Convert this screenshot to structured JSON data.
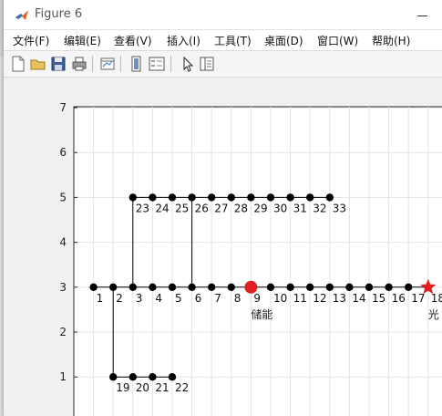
{
  "window": {
    "title": "Figure 6"
  },
  "menu": {
    "items": [
      {
        "label": "文件(F)"
      },
      {
        "label": "编辑(E)"
      },
      {
        "label": "查看(V)"
      },
      {
        "label": "插入(I)"
      },
      {
        "label": "工具(T)"
      },
      {
        "label": "桌面(D)"
      },
      {
        "label": "窗口(W)"
      },
      {
        "label": "帮助(H)"
      }
    ]
  },
  "toolbar": {
    "buttons": [
      "new-figure-icon",
      "open-file-icon",
      "save-icon",
      "print-icon",
      "link-plot-icon",
      "insert-colorbar-icon",
      "insert-legend-icon",
      "pointer-icon",
      "property-inspector-icon"
    ]
  },
  "colors": {
    "node": "#000000",
    "storage_node": "#e02020",
    "pv_marker": "#e02020",
    "grid": "#e3e3e3"
  },
  "chart_data": {
    "type": "scatter",
    "title": "",
    "xlabel": "",
    "ylabel": "",
    "ylim": [
      0,
      7
    ],
    "ytick_labels": [
      "7",
      "6",
      "5",
      "4",
      "3",
      "2",
      "1"
    ],
    "grid": true,
    "nodes": [
      {
        "id": "1",
        "x": 1,
        "y": 3
      },
      {
        "id": "2",
        "x": 2,
        "y": 3
      },
      {
        "id": "3",
        "x": 3,
        "y": 3
      },
      {
        "id": "4",
        "x": 4,
        "y": 3
      },
      {
        "id": "5",
        "x": 5,
        "y": 3
      },
      {
        "id": "6",
        "x": 6,
        "y": 3
      },
      {
        "id": "7",
        "x": 7,
        "y": 3
      },
      {
        "id": "8",
        "x": 8,
        "y": 3
      },
      {
        "id": "9",
        "x": 9,
        "y": 3,
        "kind": "storage"
      },
      {
        "id": "10",
        "x": 10,
        "y": 3
      },
      {
        "id": "11",
        "x": 11,
        "y": 3
      },
      {
        "id": "12",
        "x": 12,
        "y": 3
      },
      {
        "id": "13",
        "x": 13,
        "y": 3
      },
      {
        "id": "14",
        "x": 14,
        "y": 3
      },
      {
        "id": "15",
        "x": 15,
        "y": 3
      },
      {
        "id": "16",
        "x": 16,
        "y": 3
      },
      {
        "id": "17",
        "x": 17,
        "y": 3
      },
      {
        "id": "18",
        "x": 18,
        "y": 3,
        "kind": "pv"
      },
      {
        "id": "19",
        "x": 2,
        "y": 1
      },
      {
        "id": "20",
        "x": 3,
        "y": 1
      },
      {
        "id": "21",
        "x": 4,
        "y": 1
      },
      {
        "id": "22",
        "x": 5,
        "y": 1
      },
      {
        "id": "23",
        "x": 3,
        "y": 5
      },
      {
        "id": "24",
        "x": 4,
        "y": 5
      },
      {
        "id": "25",
        "x": 5,
        "y": 5
      },
      {
        "id": "26",
        "x": 6,
        "y": 5
      },
      {
        "id": "27",
        "x": 7,
        "y": 5
      },
      {
        "id": "28",
        "x": 8,
        "y": 5
      },
      {
        "id": "29",
        "x": 9,
        "y": 5
      },
      {
        "id": "30",
        "x": 10,
        "y": 5
      },
      {
        "id": "31",
        "x": 11,
        "y": 5
      },
      {
        "id": "32",
        "x": 12,
        "y": 5
      },
      {
        "id": "33",
        "x": 13,
        "y": 5
      }
    ],
    "edges": [
      {
        "from": "1",
        "to": "18"
      },
      {
        "from": "2",
        "to": "19"
      },
      {
        "from": "19",
        "to": "22"
      },
      {
        "from": "3",
        "to": "23"
      },
      {
        "from": "6",
        "to": "26"
      },
      {
        "from": "23",
        "to": "33"
      }
    ],
    "annotations": [
      {
        "text": "储能",
        "node": "9"
      },
      {
        "text": "光",
        "node": "18"
      }
    ]
  }
}
